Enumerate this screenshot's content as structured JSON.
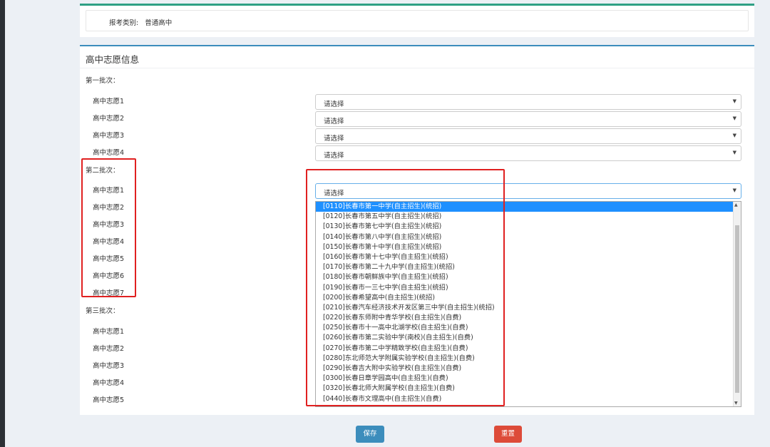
{
  "exam_type": {
    "label": "报考类别:",
    "value": "普通高中"
  },
  "section_title": "高中志愿信息",
  "batches": [
    {
      "label": "第一批次：",
      "wishes": [
        "高中志愿1",
        "高中志愿2",
        "高中志愿3",
        "高中志愿4"
      ]
    },
    {
      "label": "第二批次：",
      "wishes": [
        "高中志愿1",
        "高中志愿2",
        "高中志愿3",
        "高中志愿4",
        "高中志愿5",
        "高中志愿6",
        "高中志愿7"
      ]
    },
    {
      "label": "第三批次：",
      "wishes": [
        "高中志愿1",
        "高中志愿2",
        "高中志愿3",
        "高中志愿4",
        "高中志愿5"
      ]
    }
  ],
  "select_placeholder": "请选择",
  "dropdown_options": [
    "[0110]长春市第一中学(自主招生)(统招)",
    "[0120]长春市第五中学(自主招生)(统招)",
    "[0130]长春市第七中学(自主招生)(统招)",
    "[0140]长春市第八中学(自主招生)(统招)",
    "[0150]长春市第十中学(自主招生)(统招)",
    "[0160]长春市第十七中学(自主招生)(统招)",
    "[0170]长春市第二十九中学(自主招生)(统招)",
    "[0180]长春市朝鲜族中学(自主招生)(统招)",
    "[0190]长春市一三七中学(自主招生)(统招)",
    "[0200]长春希望高中(自主招生)(统招)",
    "[0210]长春汽车经济技术开发区第三中学(自主招生)(统招)",
    "[0220]长春东师附中青华学校(自主招生)(自费)",
    "[0250]长春市十一高中北湖学校(自主招生)(自费)",
    "[0260]长春市第二实验中学(南校)(自主招生)(自费)",
    "[0270]长春市第二中学精致学校(自主招生)(自费)",
    "[0280]东北师范大学附属实验学校(自主招生)(自费)",
    "[0290]长春吉大附中实验学校(自主招生)(自费)",
    "[0300]长春日章学园高中(自主招生)(自费)",
    "[0320]长春北师大附属学校(自主招生)(自费)",
    "[0440]长春市文理高中(自主招生)(自费)"
  ],
  "buttons": {
    "save": "保存",
    "reset": "重置"
  },
  "colors": {
    "save": "#3c8dbc",
    "reset": "#dd4b39",
    "highlight_box": "#e02020",
    "selected_option": "#1e90ff"
  }
}
